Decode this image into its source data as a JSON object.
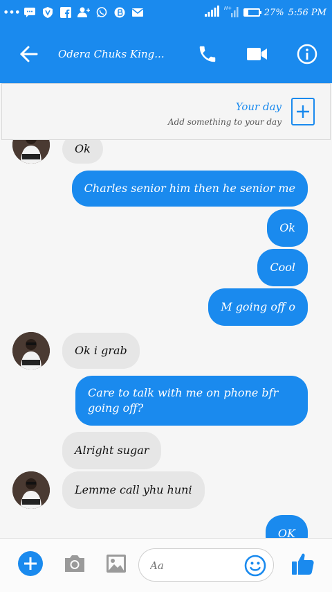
{
  "status_bar": {
    "battery": "27%",
    "battery_level": 0.27,
    "time": "5:56 PM"
  },
  "header": {
    "title": "Odera Chuks King..."
  },
  "your_day": {
    "title": "Your day",
    "subtitle": "Add something to your day"
  },
  "messages": [
    {
      "direction": "in",
      "text": "Ok"
    },
    {
      "direction": "out",
      "text": "Charles senior him then he senior me"
    },
    {
      "direction": "out",
      "text": "Ok"
    },
    {
      "direction": "out",
      "text": "Cool"
    },
    {
      "direction": "out",
      "text": "M going off o"
    },
    {
      "direction": "in",
      "text": "Ok i grab"
    },
    {
      "direction": "out",
      "text": "Care to talk with me on phone bfr going off?"
    },
    {
      "direction": "in",
      "text": "Alright sugar"
    },
    {
      "direction": "in",
      "text": "Lemme call yhu huni"
    },
    {
      "direction": "out",
      "text": "OK"
    }
  ],
  "composer": {
    "placeholder": "Aa"
  },
  "colors": {
    "accent": "#1a8aee",
    "incoming_bubble": "#e6e6e6",
    "background": "#f6f6f6"
  }
}
